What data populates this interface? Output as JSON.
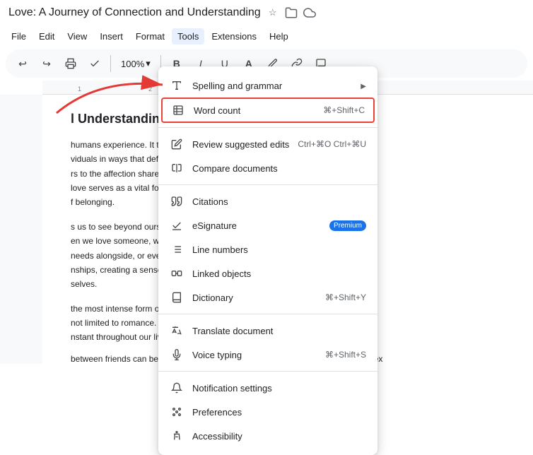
{
  "title": {
    "text": "Love: A Journey of Connection and Understanding",
    "star_icon": "★",
    "folder_icon": "📁",
    "cloud_icon": "☁"
  },
  "menubar": {
    "items": [
      {
        "label": "File",
        "id": "file"
      },
      {
        "label": "Edit",
        "id": "edit"
      },
      {
        "label": "View",
        "id": "view"
      },
      {
        "label": "Insert",
        "id": "insert"
      },
      {
        "label": "Format",
        "id": "format"
      },
      {
        "label": "Tools",
        "id": "tools",
        "active": true
      },
      {
        "label": "Extensions",
        "id": "extensions"
      },
      {
        "label": "Help",
        "id": "help"
      }
    ]
  },
  "toolbar": {
    "zoom": "100%",
    "zoom_arrow": "▾"
  },
  "document": {
    "title": "l Understanding",
    "paragraphs": [
      "humans experience. It transcends cultu",
      "viduals in ways that defy logic. Love ca",
      "rs to the affection shared by friends, t",
      "love serves as a vital foundation in ou",
      "f belonging.",
      "",
      "s us to see beyond ourselves, recogniz",
      "en we love someone, we become attu",
      "needs alongside, or even before, our",
      "nships, creating a sense of safety and",
      "selves.",
      "",
      "the most intense form of love. It inspi",
      "not limited to romance. There is famili",
      "nstant throughout our lives. Similarly, p",
      "between friends can be just as powerful, offering companionship and loyalty that ex"
    ]
  },
  "tools_menu": {
    "items": [
      {
        "id": "spelling",
        "icon": "abc-check",
        "label": "Spelling and grammar",
        "shortcut": "",
        "has_submenu": true,
        "section": 1
      },
      {
        "id": "word-count",
        "icon": "word-count",
        "label": "Word count",
        "shortcut": "⌘+Shift+C",
        "highlighted": true,
        "section": 1
      },
      {
        "id": "review-edits",
        "icon": "review",
        "label": "Review suggested edits",
        "shortcut": "Ctrl+⌘O Ctrl+⌘U",
        "section": 2
      },
      {
        "id": "compare",
        "icon": "compare",
        "label": "Compare documents",
        "shortcut": "",
        "section": 2
      },
      {
        "id": "citations",
        "icon": "citations",
        "label": "Citations",
        "shortcut": "",
        "section": 3
      },
      {
        "id": "esignature",
        "icon": "esignature",
        "label": "eSignature",
        "shortcut": "",
        "badge": "Premium",
        "section": 3
      },
      {
        "id": "line-numbers",
        "icon": "line-numbers",
        "label": "Line numbers",
        "shortcut": "",
        "section": 3
      },
      {
        "id": "linked-objects",
        "icon": "linked-objects",
        "label": "Linked objects",
        "shortcut": "",
        "section": 3
      },
      {
        "id": "dictionary",
        "icon": "dictionary",
        "label": "Dictionary",
        "shortcut": "⌘+Shift+Y",
        "section": 3
      },
      {
        "id": "translate",
        "icon": "translate",
        "label": "Translate document",
        "shortcut": "",
        "section": 4
      },
      {
        "id": "voice-typing",
        "icon": "voice-typing",
        "label": "Voice typing",
        "shortcut": "⌘+Shift+S",
        "section": 4
      },
      {
        "id": "notification-settings",
        "icon": "notification",
        "label": "Notification settings",
        "shortcut": "",
        "section": 5
      },
      {
        "id": "preferences",
        "icon": "preferences",
        "label": "Preferences",
        "shortcut": "",
        "section": 5
      },
      {
        "id": "accessibility",
        "icon": "accessibility",
        "label": "Accessibility",
        "shortcut": "",
        "section": 5
      }
    ]
  }
}
